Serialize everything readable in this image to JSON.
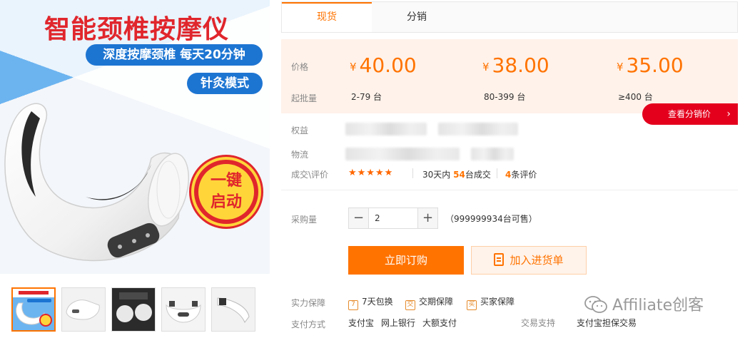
{
  "product_image": {
    "title": "智能颈椎按摩仪",
    "subtitle": "深度按摩颈椎 每天20分钟",
    "mode": "针灸模式",
    "badge_line1": "一键",
    "badge_line2": "启动"
  },
  "tabs": [
    {
      "label": "现货",
      "active": true
    },
    {
      "label": "分销",
      "active": false
    }
  ],
  "pricing": {
    "price_label": "价格",
    "moq_label": "起批量",
    "currency": "¥",
    "tiers": [
      {
        "price": "40.00",
        "range": "2-79 台"
      },
      {
        "price": "38.00",
        "range": "80-399 台"
      },
      {
        "price": "35.00",
        "range": "≥400 台"
      }
    ],
    "distribution_button": "查看分销价",
    "accent_color": "#ff7300"
  },
  "info": {
    "rights_label": "权益",
    "logistics_label": "物流",
    "review_label": "成交\\评价",
    "stars": "★★★★★",
    "sales_prefix": "30天内",
    "sales_count": "54",
    "sales_suffix": "台成交",
    "review_count": "4",
    "review_suffix": "条评价"
  },
  "purchase": {
    "qty_label": "采购量",
    "qty_value": "2",
    "minus": "−",
    "plus": "+",
    "available": "（999999934台可售）",
    "buy_button": "立即订购",
    "cart_button": "加入进货单"
  },
  "guarantee": {
    "label": "实力保障",
    "items": [
      {
        "icon": "7",
        "text": "7天包换"
      },
      {
        "icon": "交",
        "text": "交期保障"
      },
      {
        "icon": "买",
        "text": "买家保障"
      }
    ]
  },
  "payment": {
    "label": "支付方式",
    "methods": [
      "支付宝",
      "网上银行",
      "大额支付"
    ],
    "trade_label": "交易支持",
    "trade_value": "支付宝担保交易"
  },
  "watermark": "Affiliate创客"
}
